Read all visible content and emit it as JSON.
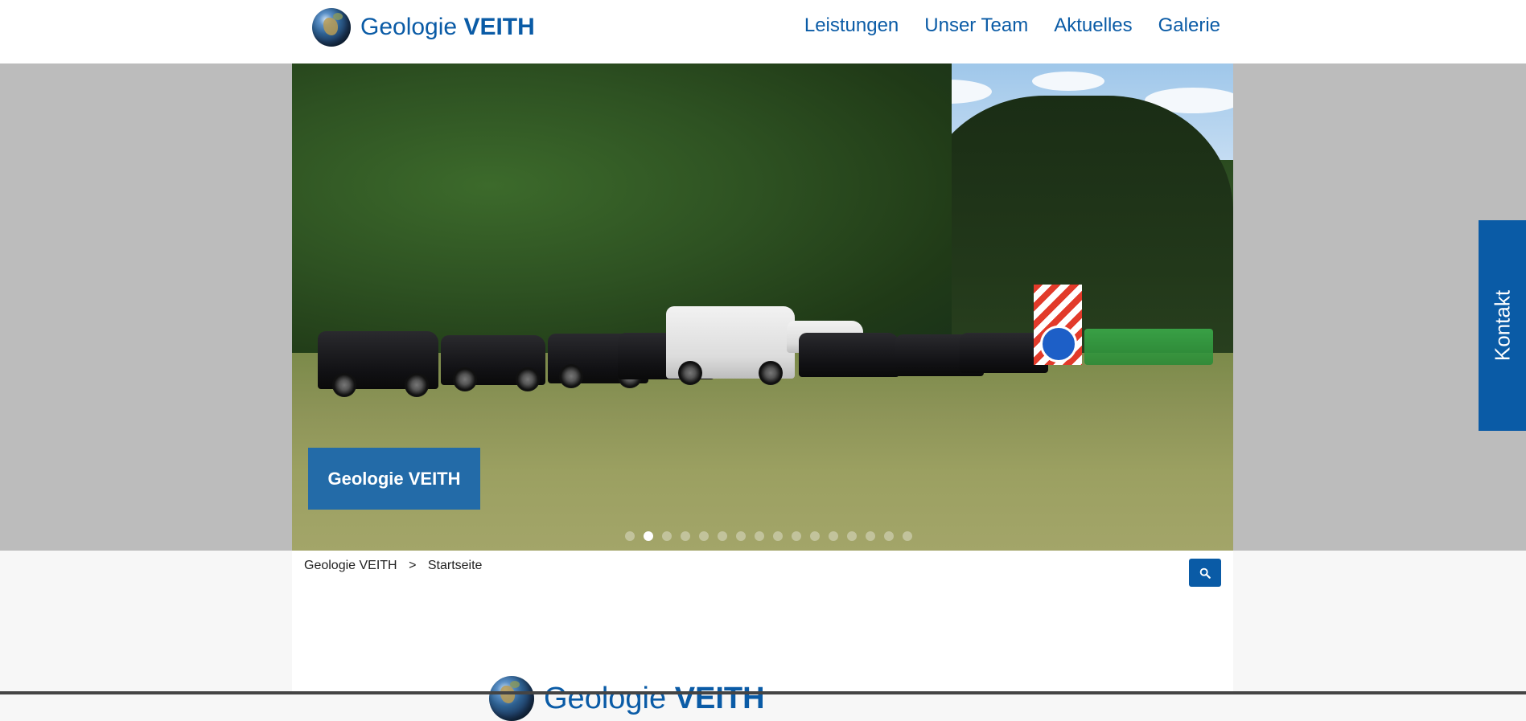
{
  "header": {
    "logo_text_light": "Geologie",
    "logo_text_bold": "VEITH",
    "nav": [
      {
        "label": "Leistungen"
      },
      {
        "label": "Unser Team"
      },
      {
        "label": "Aktuelles"
      },
      {
        "label": "Galerie"
      }
    ]
  },
  "hero": {
    "caption": "Geologie VEITH",
    "slide_count": 16,
    "active_slide": 2
  },
  "breadcrumb": {
    "home": "Geologie VEITH",
    "separator": ">",
    "current": "Startseite"
  },
  "search": {
    "icon": "search-icon"
  },
  "side_tab": {
    "label": "Kontakt"
  },
  "footer_logo": {
    "logo_text_light": "Geologie",
    "logo_text_bold": "VEITH"
  },
  "colors": {
    "brand_blue": "#0a5ba6",
    "caption_blue": "#236ba8",
    "hero_band_gray": "#bcbcbc"
  }
}
